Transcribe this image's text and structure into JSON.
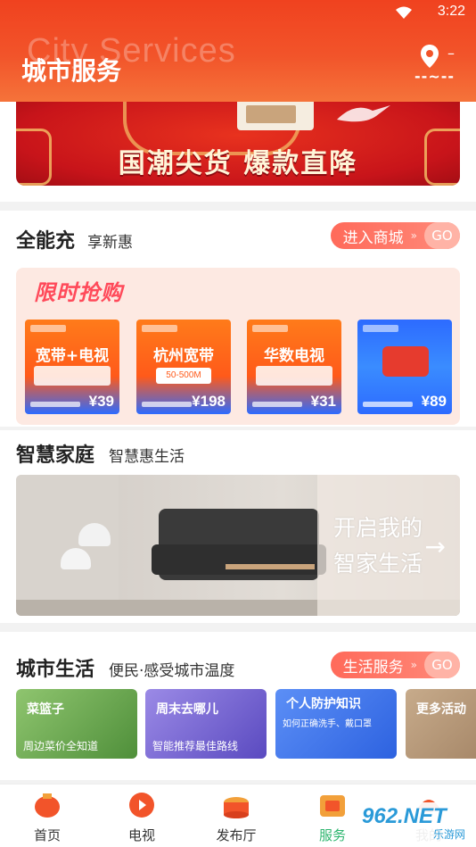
{
  "status": {
    "time": "3:22"
  },
  "header": {
    "title": "城市服务",
    "ghost_text": "City Services",
    "location_dash": "–",
    "location_wave": "--~--"
  },
  "banner": {
    "text": "国潮尖货 爆款直降"
  },
  "quick_charge": {
    "title": "全能充",
    "subtitle": "享新惠",
    "pill_label": "进入商城",
    "pill_go": "GO",
    "flash_title": "限时抢购",
    "products": [
      {
        "name": "宽带+电视",
        "price": "¥39"
      },
      {
        "name": "杭州宽带",
        "tag": "50-500M",
        "price": "¥198"
      },
      {
        "name": "华数电视",
        "price": "¥31"
      },
      {
        "name": "",
        "price": "¥89"
      }
    ]
  },
  "smart_home": {
    "title": "智慧家庭",
    "subtitle": "智慧惠生活",
    "cta_line1": "开启我的",
    "cta_line2": "智家生活",
    "arrow": "→"
  },
  "city_life": {
    "title": "城市生活",
    "subtitle": "便民·感受城市温度",
    "pill_label": "生活服务",
    "pill_go": "GO",
    "cards": [
      {
        "title": "菜篮子",
        "sub": "周边菜价全知道",
        "color": "#6aa84f"
      },
      {
        "title": "周末去哪儿",
        "sub": "智能推荐最佳路线",
        "color": "#7a6ad8"
      },
      {
        "title": "个人防护知识",
        "sub": "如何正确洗手、戴口罩",
        "color": "#3c7df0"
      },
      {
        "title": "更多活动",
        "sub": "",
        "color": "#b89a7a"
      }
    ]
  },
  "nav": {
    "items": [
      {
        "label": "首页",
        "icon": "home-icon"
      },
      {
        "label": "电视",
        "icon": "tv-icon"
      },
      {
        "label": "发布厅",
        "icon": "hall-icon"
      },
      {
        "label": "服务",
        "icon": "service-icon"
      },
      {
        "label": "我的",
        "icon": "mine-icon"
      }
    ]
  },
  "watermark": {
    "main": "962.NET",
    "sub": "乐游网"
  },
  "colors": {
    "accent": "#f0421f",
    "active_nav": "#2db56e",
    "pill": "#ff6a5a"
  }
}
